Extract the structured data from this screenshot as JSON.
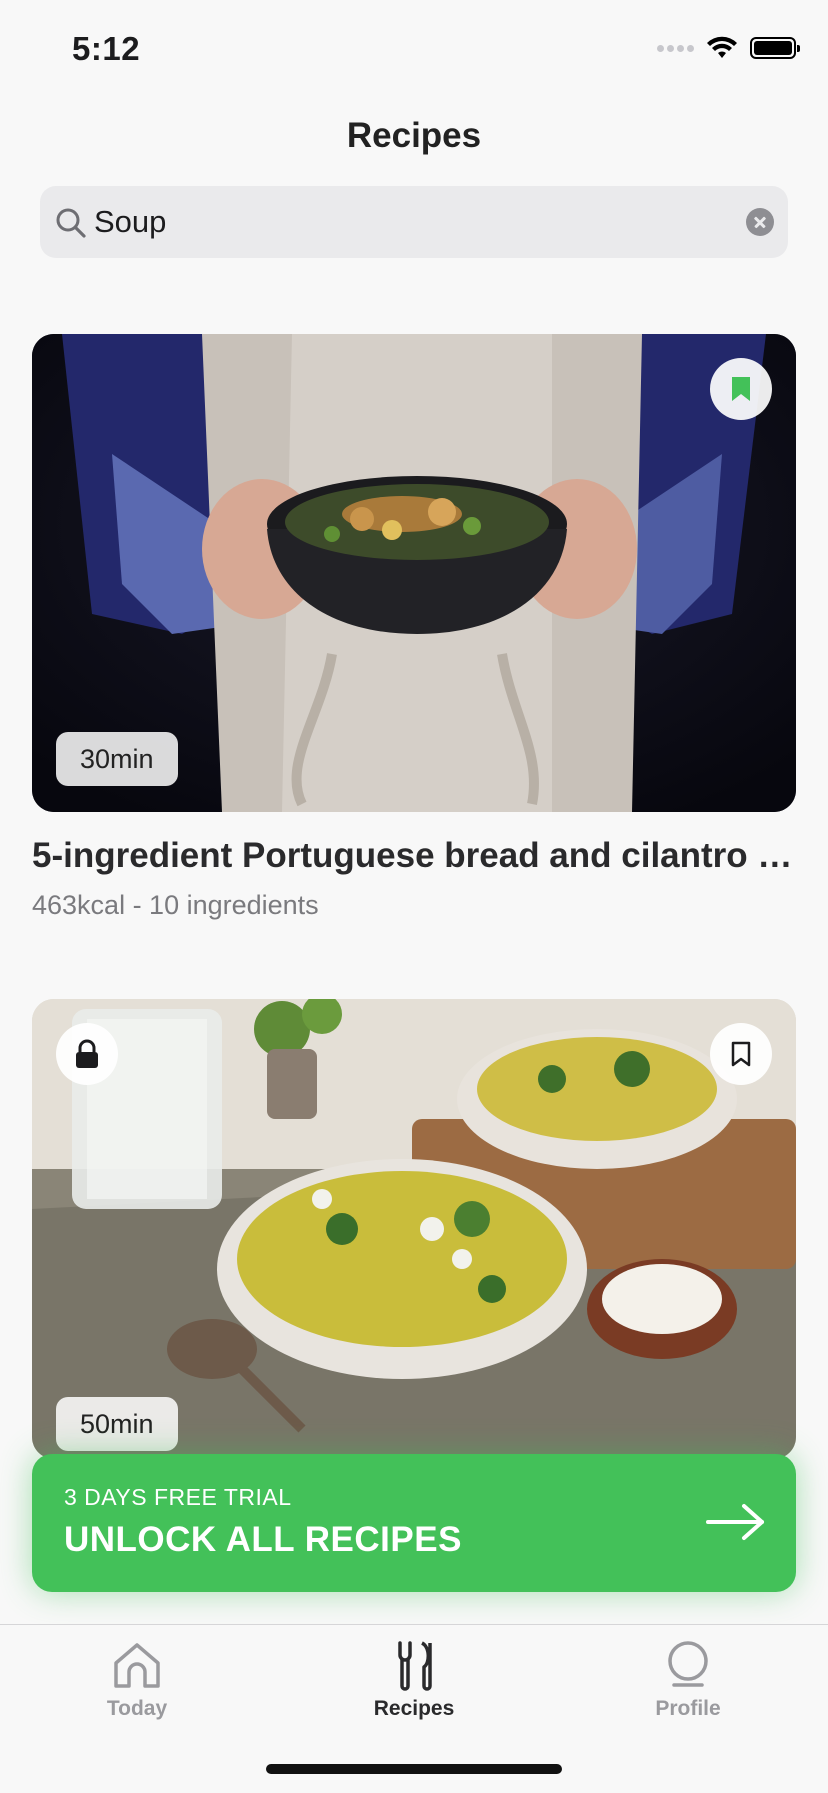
{
  "status_bar": {
    "time": "5:12"
  },
  "header": {
    "title": "Recipes"
  },
  "search": {
    "value": "Soup",
    "placeholder": "Search"
  },
  "recipes": [
    {
      "duration": "30min",
      "title": "5-ingredient Portuguese bread and cilantro so…",
      "meta": "463kcal - 10 ingredients",
      "bookmarked": true
    },
    {
      "duration": "50min",
      "locked": true,
      "bookmarked": false
    }
  ],
  "cta": {
    "subtitle": "3 DAYS FREE TRIAL",
    "title": "UNLOCK ALL RECIPES"
  },
  "tabs": [
    {
      "label": "Today",
      "icon": "home-icon"
    },
    {
      "label": "Recipes",
      "icon": "fork-knife-icon",
      "active": true
    },
    {
      "label": "Profile",
      "icon": "profile-icon"
    }
  ],
  "colors": {
    "accent": "#43c159",
    "background": "#f8f8f8"
  }
}
